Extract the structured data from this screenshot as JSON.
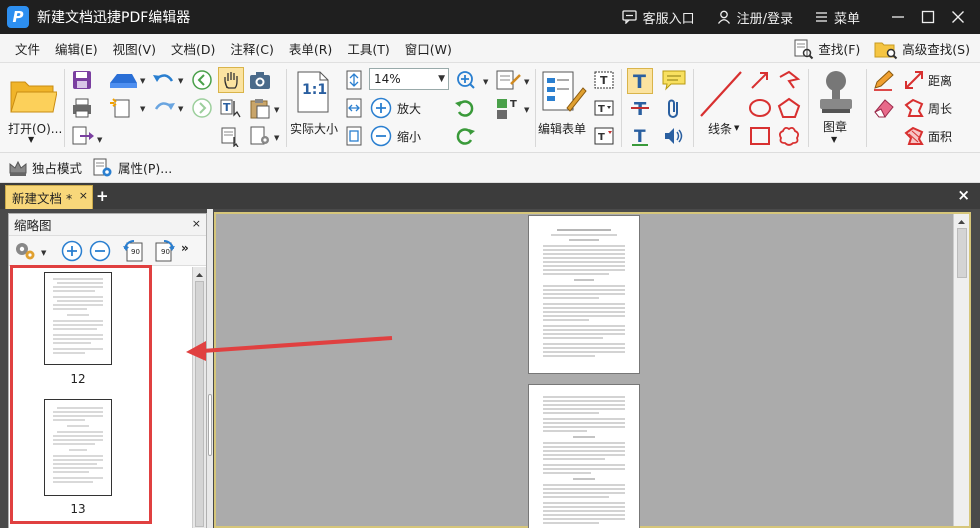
{
  "app": {
    "logo_letter": "P",
    "title": "新建文档迅捷PDF编辑器",
    "customer_service": "客服入口",
    "register_login": "注册/登录",
    "menu": "菜单"
  },
  "menubar": {
    "items": [
      "文件",
      "编辑(E)",
      "视图(V)",
      "文档(D)",
      "注释(C)",
      "表单(R)",
      "工具(T)",
      "窗口(W)"
    ],
    "find": "查找(F)",
    "advanced_find": "高级查找(S)"
  },
  "ribbon": {
    "open_label": "打开(O)...",
    "zoom_value": "14%",
    "actual_size": "实际大小",
    "zoom_in": "放大",
    "zoom_out": "缩小",
    "edit_form": "编辑表单",
    "line": "线条",
    "stamp": "图章",
    "distance": "距离",
    "perimeter": "周长",
    "area": "面积",
    "fit_label": "1:1"
  },
  "modebar": {
    "exclusive_mode": "独占模式",
    "properties": "属性(P)..."
  },
  "tabs": {
    "doc_tab": "新建文档 *",
    "close": "×",
    "add": "+"
  },
  "sidepanel": {
    "title": "缩略图",
    "close": "×",
    "rotate_left_label": "90",
    "rotate_right_label": "90",
    "thumbnails": [
      {
        "page": "12"
      },
      {
        "page": "13"
      }
    ]
  },
  "colors": {
    "accent": "#2d8ff0",
    "tab_active": "#f8d77a",
    "annotation_red": "#e04040"
  }
}
